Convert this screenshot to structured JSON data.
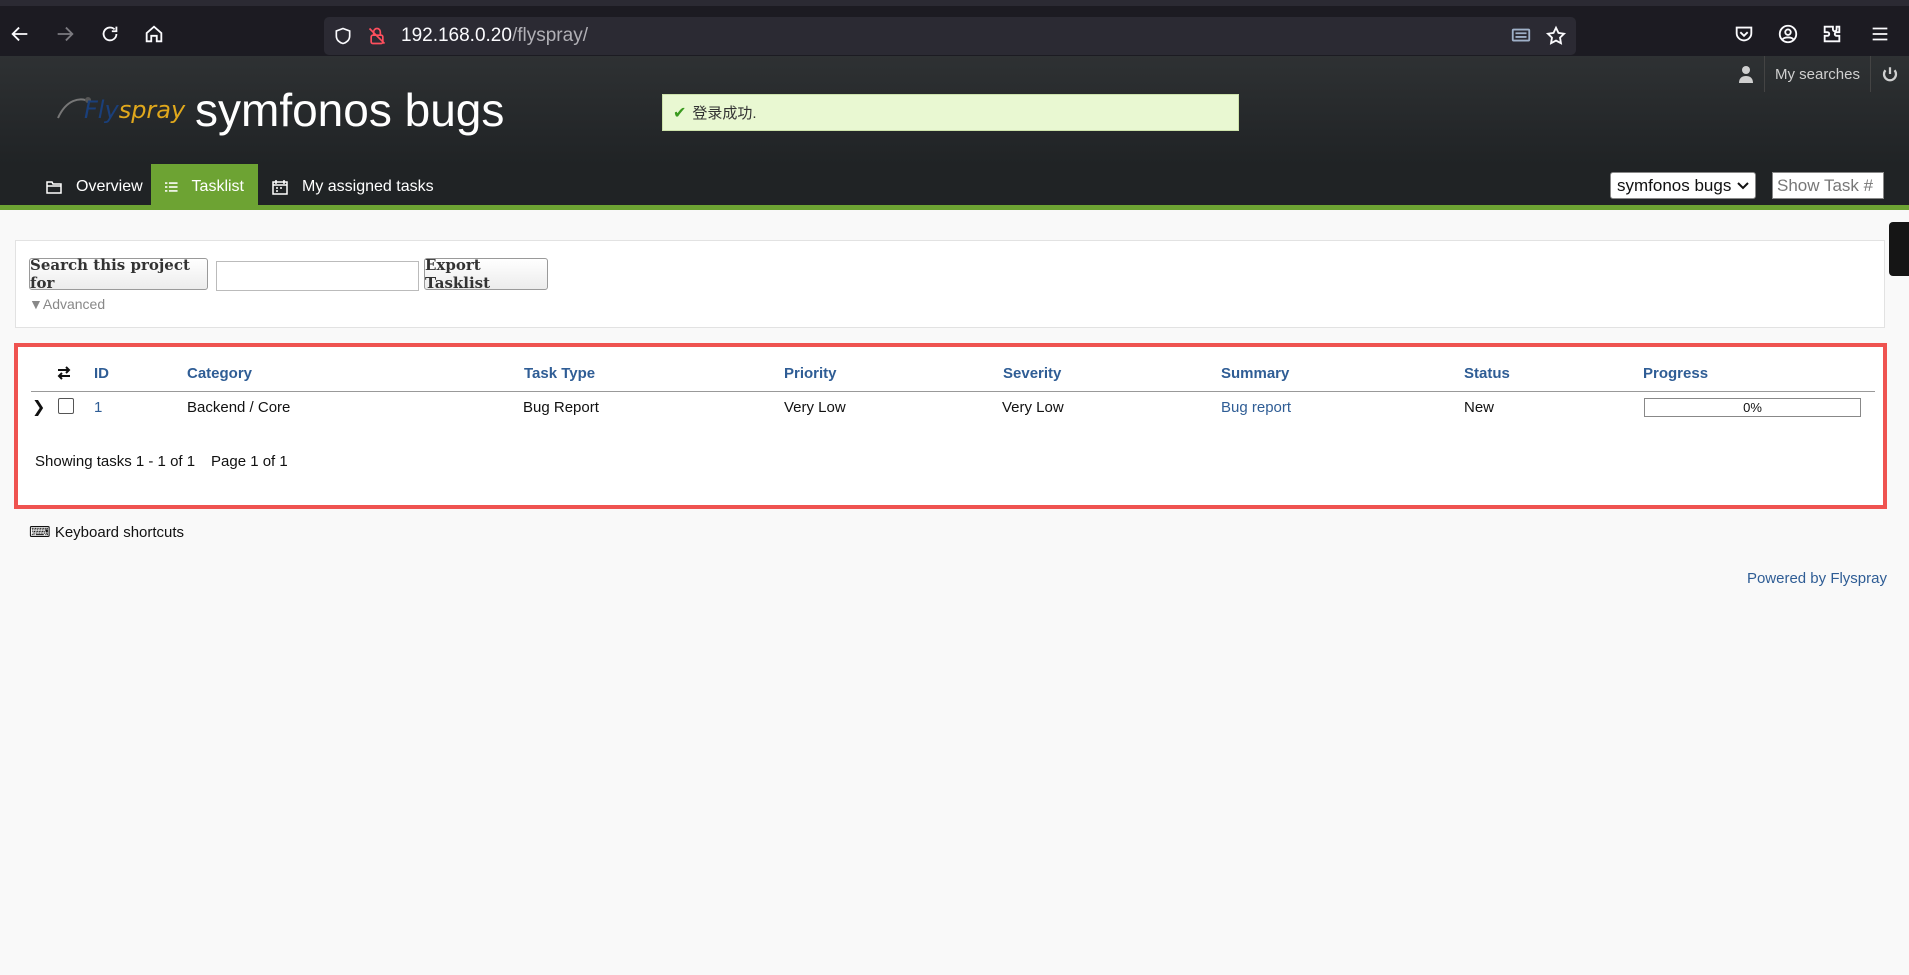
{
  "browser": {
    "url_host": "192.168.0.20",
    "url_path": "/flyspray/"
  },
  "header": {
    "logo_fly": "Fly",
    "logo_spray": "spray",
    "title": "symfonos bugs",
    "success_message": "登录成功.",
    "my_searches": "My searches"
  },
  "tabs": [
    {
      "label": "Overview",
      "active": false
    },
    {
      "label": "Tasklist",
      "active": true
    },
    {
      "label": "My assigned tasks",
      "active": false
    }
  ],
  "project_select": {
    "value": "symfonos bugs"
  },
  "show_task": {
    "placeholder": "Show Task #"
  },
  "search": {
    "search_button": "Search this project for",
    "export_button": "Export Tasklist",
    "advanced": "▼Advanced"
  },
  "tasklist": {
    "columns": [
      "ID",
      "Category",
      "Task Type",
      "Priority",
      "Severity",
      "Summary",
      "Status",
      "Progress"
    ],
    "rows": [
      {
        "id": "1",
        "category": "Backend / Core",
        "task_type": "Bug Report",
        "priority": "Very Low",
        "severity": "Very Low",
        "summary": "Bug report",
        "status": "New",
        "progress": 0,
        "progress_label": "0%"
      }
    ],
    "showing": "Showing tasks 1 - 1 of 1",
    "page": "Page 1 of 1"
  },
  "footer": {
    "keyboard_shortcuts": "⌨ Keyboard shortcuts",
    "powered_by": "Powered by Flyspray"
  },
  "colors": {
    "accent_green": "#6da333",
    "link_blue": "#2f5d95",
    "highlight_red": "#ef5350"
  }
}
